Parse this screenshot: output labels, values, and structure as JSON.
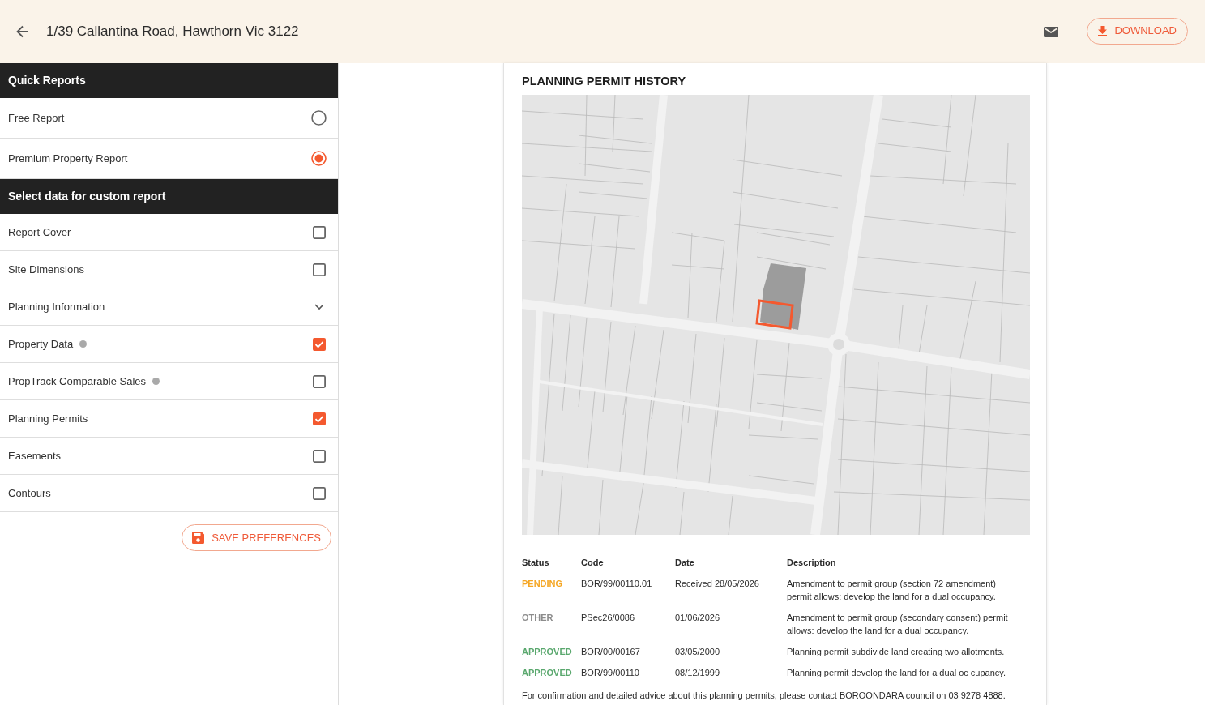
{
  "header": {
    "title": "1/39 Callantina Road, Hawthorn Vic 3122",
    "download_button": "DOWNLOAD"
  },
  "sidebar": {
    "sections": [
      {
        "title": "Quick Reports",
        "items": [
          {
            "kind": "radio",
            "label": "Free Report",
            "selected": false
          },
          {
            "kind": "radio",
            "label": "Premium Property Report",
            "selected": true
          }
        ]
      },
      {
        "title": "Select data for custom report",
        "items": [
          {
            "kind": "checkbox",
            "label": "Report Cover",
            "checked": false
          },
          {
            "kind": "checkbox",
            "label": "Site Dimensions",
            "checked": false
          },
          {
            "kind": "expander",
            "label": "Planning Information",
            "expanded": false
          },
          {
            "kind": "checkbox",
            "label": "Property Data",
            "checked": true,
            "info": true
          },
          {
            "kind": "checkbox",
            "label": "PropTrack Comparable Sales",
            "checked": false,
            "info": true
          },
          {
            "kind": "checkbox",
            "label": "Planning Permits",
            "checked": true
          },
          {
            "kind": "checkbox",
            "label": "Easements",
            "checked": false
          },
          {
            "kind": "checkbox",
            "label": "Contours",
            "checked": false
          }
        ]
      }
    ],
    "save_button": "SAVE PREFERENCES"
  },
  "permit_history": {
    "title": "PLANNING PERMIT HISTORY",
    "table": {
      "columns": [
        "Status",
        "Code",
        "Date",
        "Description"
      ],
      "rows": [
        {
          "status": "PENDING",
          "color": "#f5a623",
          "code": "BOR/99/00110.01",
          "date": "Received 28/05/2026",
          "description": "Amendment to permit group (section 72 amendment) permit allows: develop the land for a dual occupancy."
        },
        {
          "status": "OTHER",
          "color": "#8c8c8c",
          "code": "PSec26/0086",
          "date": "01/06/2026",
          "description": "Amendment to permit group (secondary consent) permit allows: develop the land for a dual occupancy."
        },
        {
          "status": "APPROVED",
          "color": "#5aa86e",
          "code": "BOR/00/00167",
          "date": "03/05/2000",
          "description": "Planning permit subdivide land creating two allotments."
        },
        {
          "status": "APPROVED",
          "color": "#5aa86e",
          "code": "BOR/99/00110",
          "date": "08/12/1999",
          "description": "Planning permit develop the land for a dual oc cupancy."
        }
      ]
    },
    "note": "For confirmation and detailed advice about this planning permits, please contact BOROONDARA council on 03 9278 4888."
  }
}
